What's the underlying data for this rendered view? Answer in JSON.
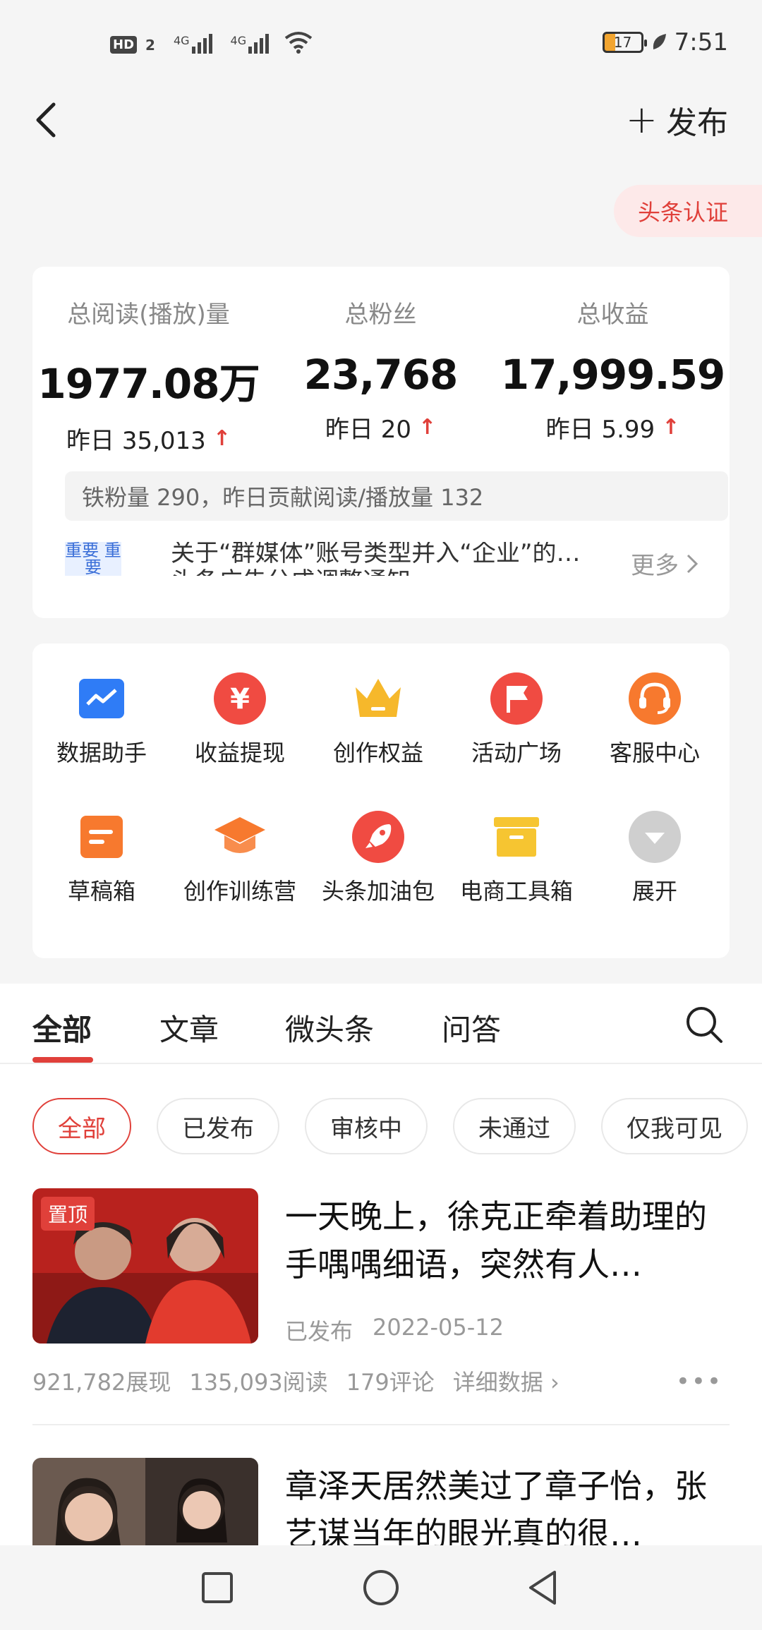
{
  "status_bar": {
    "hd_label": "HD",
    "sim_label": "2",
    "net1": "4G",
    "net2": "4G",
    "battery": "17",
    "time": "7:51"
  },
  "header": {
    "publish_label": "发布",
    "cert_label": "头条认证"
  },
  "stats": {
    "items": [
      {
        "label": "总阅读(播放)量",
        "value": "1977.08万",
        "yesterday": "昨日 35,013"
      },
      {
        "label": "总粉丝",
        "value": "23,768",
        "yesterday": "昨日 20"
      },
      {
        "label": "总收益",
        "value": "17,999.59",
        "yesterday": "昨日 5.99"
      }
    ],
    "fans_info": "铁粉量 290，昨日贡献阅读/播放量 132",
    "notice_tag": "重要 重要",
    "notice_line1": "关于“群媒体”账号类型并入“企业”的…",
    "notice_line2": "头条广告分成调整通知",
    "more_label": "更多"
  },
  "tools": [
    {
      "label": "数据助手",
      "icon": "chart-icon",
      "color": "#2f7cf6"
    },
    {
      "label": "收益提现",
      "icon": "yuan-icon",
      "color": "#f04b42"
    },
    {
      "label": "创作权益",
      "icon": "crown-icon",
      "color": "#f6b82b"
    },
    {
      "label": "活动广场",
      "icon": "flag-icon",
      "color": "#f04b42"
    },
    {
      "label": "客服中心",
      "icon": "headset-icon",
      "color": "#f7792e"
    },
    {
      "label": "草稿箱",
      "icon": "draft-icon",
      "color": "#f7792e"
    },
    {
      "label": "创作训练营",
      "icon": "grad-cap-icon",
      "color": "#f7792e"
    },
    {
      "label": "头条加油包",
      "icon": "rocket-icon",
      "color": "#f04b42"
    },
    {
      "label": "电商工具箱",
      "icon": "box-icon",
      "color": "#f6c531"
    },
    {
      "label": "展开",
      "icon": "expand-icon",
      "color": "#cfcfcf"
    }
  ],
  "tabs": [
    "全部",
    "文章",
    "微头条",
    "问答"
  ],
  "filters": [
    "全部",
    "已发布",
    "审核中",
    "未通过",
    "仅我可见"
  ],
  "articles": [
    {
      "pin": "置顶",
      "title": "一天晚上，徐克正牵着助理的手喁喁细语，突然有人…",
      "status": "已发布",
      "date": "2022-05-12",
      "impressions": "921,782展现",
      "reads": "135,093阅读",
      "comments": "179评论",
      "details": "详细数据"
    },
    {
      "title": "章泽天居然美过了章子怡，张艺谋当年的眼光真的很…"
    }
  ]
}
